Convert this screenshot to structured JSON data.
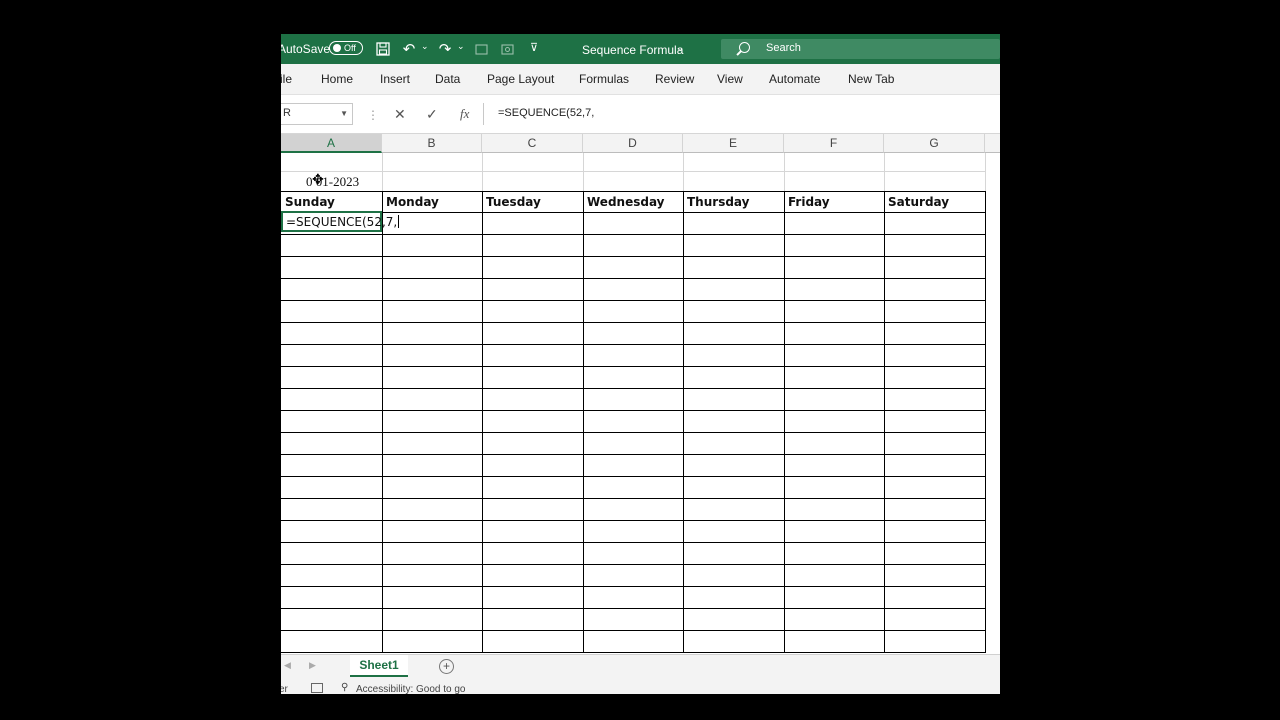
{
  "titlebar": {
    "autosave_label": "AutoSave",
    "autosave_state": "Off",
    "document_title": "Sequence Formula",
    "search_placeholder": "Search"
  },
  "ribbon": {
    "tabs": [
      "ile",
      "Home",
      "Insert",
      "Data",
      "Page Layout",
      "Formulas",
      "Review",
      "View",
      "Automate",
      "New Tab"
    ]
  },
  "formula_bar": {
    "name_box": "R",
    "cancel_icon": "✕",
    "enter_icon": "✓",
    "fx_label": "fx",
    "formula": "=SEQUENCE(52,7,"
  },
  "columns": [
    "A",
    "B",
    "C",
    "D",
    "E",
    "F",
    "G"
  ],
  "sheet": {
    "date_cell": "0 01-2023",
    "days": [
      "Sunday",
      "Monday",
      "Tuesday",
      "Wednesday",
      "Thursday",
      "Friday",
      "Saturday"
    ],
    "editing_text": "=SEQUENCE(52,7,"
  },
  "sheet_tabs": {
    "active": "Sheet1",
    "add_label": "+"
  },
  "statusbar": {
    "ready": "er",
    "accessibility": "Accessibility: Good to go"
  },
  "colors": {
    "excel_green": "#1e7145",
    "grid_line": "#d6d6d6",
    "border": "#000000"
  }
}
